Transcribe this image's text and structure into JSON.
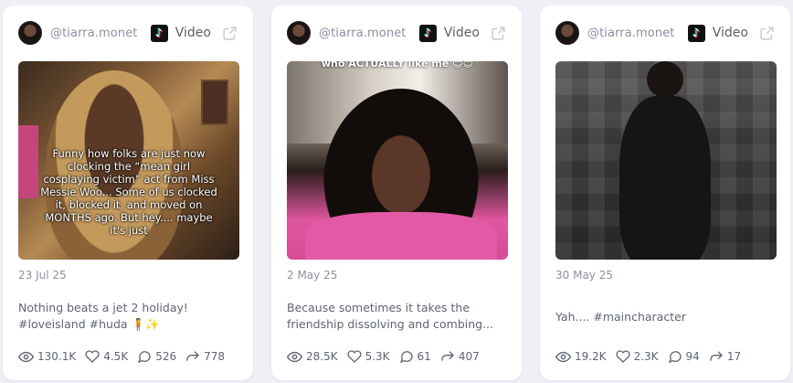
{
  "colors": {
    "background": "#eef0f6",
    "card": "#ffffff",
    "text": "#5e6472",
    "muted": "#8c92a0"
  },
  "cards": [
    {
      "handle": "@tiarra.monet",
      "platform_label": "Video",
      "platform_icon": "tiktok-icon",
      "external_icon": "external-link-icon",
      "overlay_text": "Funny how folks are just now clocking the “mean girl cosplaying victim” act from Miss Messie Woo... Some of us clocked it, blocked it, and moved on MONTHS ago. But hey.... maybe it's just",
      "date": "23 Jul 25",
      "caption": "Nothing beats a jet 2 holiday! #loveisland #huda 🧍✨",
      "stats": {
        "views": "130.1K",
        "likes": "4.5K",
        "comments": "526",
        "shares": "778"
      }
    },
    {
      "handle": "@tiarra.monet",
      "platform_label": "Video",
      "platform_icon": "tiktok-icon",
      "external_icon": "external-link-icon",
      "overlay_text": "who ACTUALLY like me 😊😊",
      "date": "2 May 25",
      "caption": "Because sometimes it takes the friendship dissolving and combing...",
      "stats": {
        "views": "28.5K",
        "likes": "5.3K",
        "comments": "61",
        "shares": "407"
      }
    },
    {
      "handle": "@tiarra.monet",
      "platform_label": "Video",
      "platform_icon": "tiktok-icon",
      "external_icon": "external-link-icon",
      "date": "30 May 25",
      "caption": "Yah.... #maincharacter",
      "stats": {
        "views": "19.2K",
        "likes": "2.3K",
        "comments": "94",
        "shares": "17"
      }
    }
  ]
}
